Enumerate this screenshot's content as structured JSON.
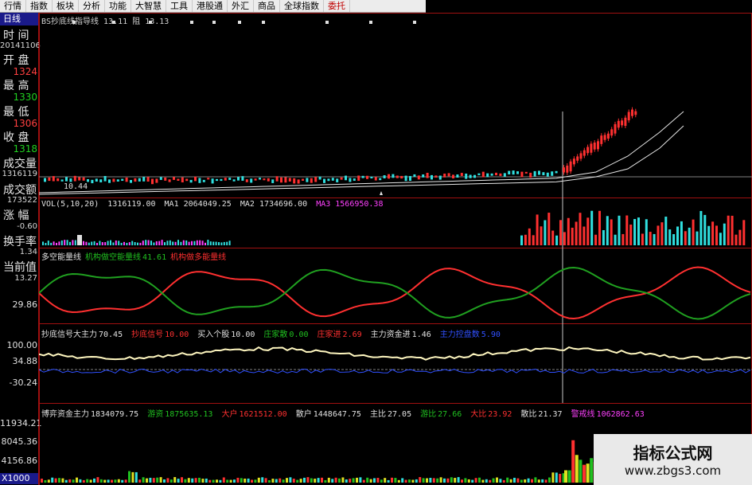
{
  "menu": {
    "items": [
      "行情",
      "指数",
      "板块",
      "分析",
      "功能",
      "大智慧",
      "工具",
      "港股通",
      "外汇",
      "商品",
      "全球指数",
      "委托"
    ]
  },
  "left_panel": {
    "day_tab": "日线",
    "time_label": "时 间",
    "time_value": "20141106",
    "open_label": "开 盘",
    "open_value": "1324",
    "high_label": "最 高",
    "high_value": "1330",
    "low_label": "最 低",
    "low_value": "1306",
    "close_label": "收 盘",
    "close_value": "1318",
    "volume_label": "成交量",
    "volume_value": "1316119",
    "amount_label": "成交额",
    "amount_value": "173522",
    "change_label": "涨 幅",
    "change_value": "-0.60",
    "turnover_label": "换手率",
    "turnover_value": "1.34",
    "current_label": "当前值",
    "current_value": "13.27",
    "axis_29": "29.86",
    "axis_100": "100.00",
    "axis_34": "34.88",
    "axis_m30": "-30.24",
    "axis_11934": "11934.21",
    "axis_8045": "8045.36",
    "axis_4156": "4156.86",
    "axis_x1000": "X1000"
  },
  "price_panel": {
    "title": "BS抄底线指导线 13.11 阻 13.13",
    "low_mark": "10.44"
  },
  "vol_panel": {
    "label": "VOL(5,10,20)",
    "vol": "1316119.00",
    "ma1": "MA1 2064049.25",
    "ma2": "MA2 1734696.00",
    "ma3": "MA3 1566950.38"
  },
  "energy_panel": {
    "title": "多空能量线",
    "short": "机构做空能量线",
    "short_val": "41.61",
    "long": "机构做多能量线"
  },
  "signal_panel": {
    "title": "抄底信号大主力",
    "title_val": "70.45",
    "sig": "抄底信号",
    "sig_val": "10.00",
    "buy": "买入个股",
    "buy_val": "10.00",
    "dealer": "庄家散",
    "dealer_val": "0.00",
    "dealer_in": "庄家进",
    "dealer_in_val": "2.69",
    "main_in": "主力资金进",
    "main_in_val": "1.46",
    "main_cost": "主力控盘数",
    "main_cost_val": "5.90"
  },
  "fund_panel": {
    "title": "博弈资金主力",
    "title_val": "1834079.75",
    "hot": "游资",
    "hot_val": "1875635.13",
    "big": "大户",
    "big_val": "1621512.00",
    "retail": "散户",
    "retail_val": "1448647.75",
    "main_ratio": "主比",
    "main_ratio_val": "27.05",
    "hot_ratio": "游比",
    "hot_ratio_val": "27.66",
    "big_ratio": "大比",
    "big_ratio_val": "23.92",
    "retail_ratio": "散比",
    "retail_ratio_val": "21.37",
    "warn": "警戒线",
    "warn_val": "1062862.63"
  },
  "watermark": {
    "cn": "指标公式网",
    "en": "www.zbgs3.com"
  },
  "colors": {
    "up": "#ff3030",
    "down": "#30e0e0",
    "frame": "#a01010",
    "menu_bg": "#ececec"
  }
}
